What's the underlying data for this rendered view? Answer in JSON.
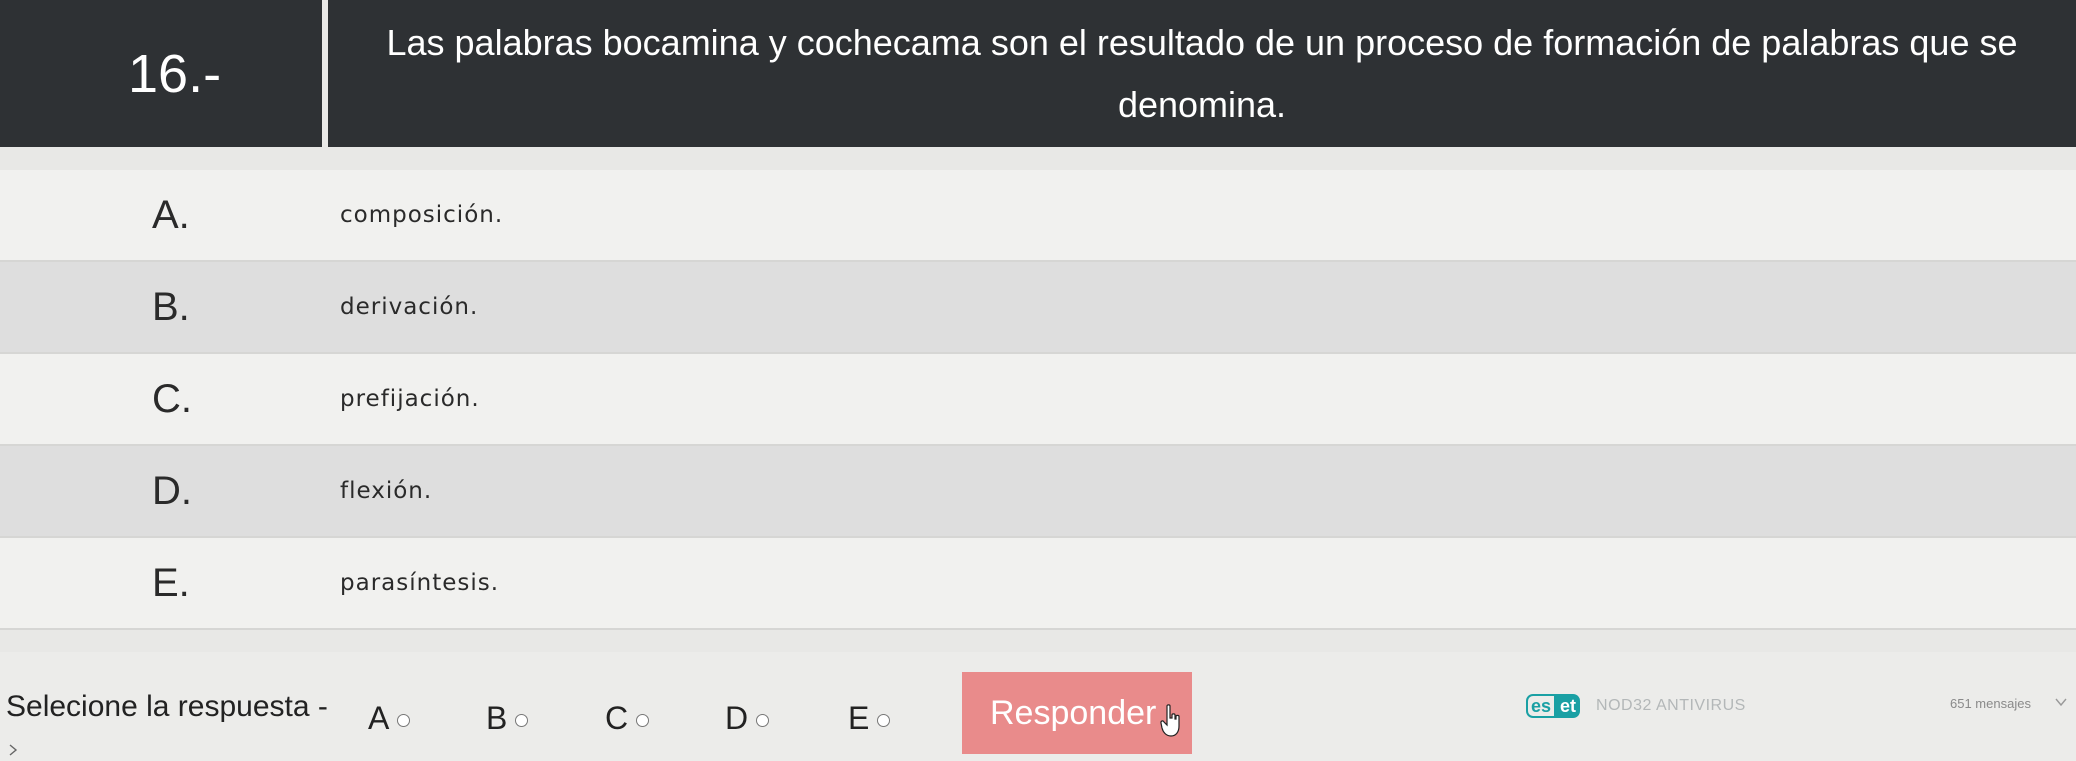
{
  "question": {
    "number": "16.-",
    "text": "Las palabras bocamina y cochecama son el resultado de un proceso de formación de palabras que se denomina."
  },
  "options": [
    {
      "letter": "A.",
      "text": "composición."
    },
    {
      "letter": "B.",
      "text": "derivación."
    },
    {
      "letter": "C.",
      "text": "prefijación."
    },
    {
      "letter": "D.",
      "text": "flexión."
    },
    {
      "letter": "E.",
      "text": "parasíntesis."
    }
  ],
  "answer_bar": {
    "label": "Selecione la respuesta -",
    "choices": [
      "A",
      "B",
      "C",
      "D",
      "E"
    ],
    "button_label": "Responder"
  },
  "overlay": {
    "eset_es": "es",
    "eset_et": "et",
    "eset_product": "NOD32 ANTIVIRUS",
    "messages": "651 mensajes"
  },
  "colors": {
    "header_bg": "#2e3134",
    "button_bg": "#e98b8b",
    "eset_teal": "#1aa0a4"
  }
}
